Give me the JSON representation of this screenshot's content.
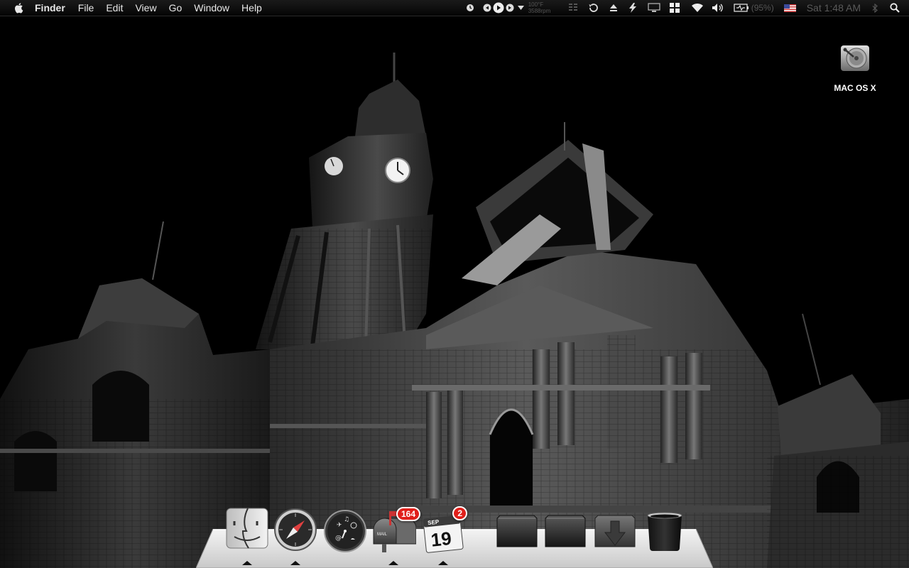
{
  "menubar": {
    "apple_icon": "apple-icon",
    "app_name": "Finder",
    "menus": [
      "File",
      "Edit",
      "View",
      "Go",
      "Window",
      "Help"
    ],
    "status": {
      "temperature_line1": "100°F",
      "temperature_line2": "3588rpm",
      "battery_percent": "(95%)",
      "clock": "Sat 1:48 AM",
      "icons": [
        "clock-icon",
        "previous-track-icon",
        "play-icon",
        "next-track-icon",
        "dropdown-icon",
        "bars-icon",
        "time-machine-icon",
        "eject-icon",
        "tool-icon",
        "display-icon",
        "spaces-icon",
        "wifi-icon",
        "volume-icon",
        "battery-icon",
        "us-flag-icon",
        "bluetooth-icon",
        "spotlight-icon"
      ]
    }
  },
  "desktop": {
    "icons": [
      {
        "label": "MAC OS X",
        "icon": "hard-drive-icon"
      }
    ]
  },
  "dock": {
    "items": [
      {
        "name": "Finder",
        "icon": "finder-icon",
        "running": true
      },
      {
        "name": "Safari",
        "icon": "safari-compass-icon",
        "running": true
      },
      {
        "name": "Dashboard",
        "icon": "dashboard-icon",
        "running": false
      },
      {
        "name": "Mail",
        "icon": "mailbox-icon",
        "badge": "164",
        "running": true
      },
      {
        "name": "iCal",
        "icon": "calendar-icon",
        "badge": "2",
        "running": true,
        "month": "SEP",
        "day": "19"
      },
      {
        "name": "Stack 1",
        "icon": "folder-stack-icon",
        "running": false
      },
      {
        "name": "Stack 2",
        "icon": "folder-stack-icon",
        "running": false
      },
      {
        "name": "Downloads",
        "icon": "downloads-icon",
        "running": false
      },
      {
        "name": "Trash",
        "icon": "trash-icon",
        "running": false
      }
    ],
    "mail_label": "MAIL"
  }
}
